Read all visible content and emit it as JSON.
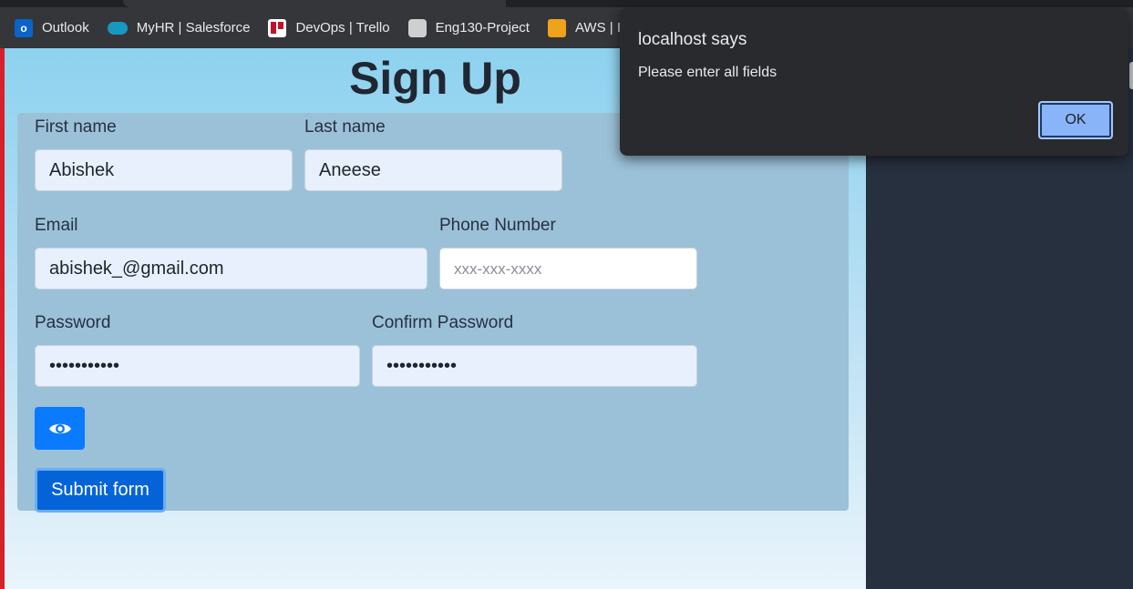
{
  "bookmarks": [
    {
      "label": "Outlook",
      "icon": "outlook-icon"
    },
    {
      "label": "MyHR | Salesforce",
      "icon": "salesforce-icon"
    },
    {
      "label": "DevOps | Trello",
      "icon": "trello-icon"
    },
    {
      "label": "Eng130-Project",
      "icon": "project-icon"
    },
    {
      "label": "AWS | Ins",
      "icon": "aws-icon"
    }
  ],
  "page": {
    "title": "Sign Up"
  },
  "form": {
    "first_name": {
      "label": "First name",
      "value": "Abishek"
    },
    "last_name": {
      "label": "Last name",
      "value": "Aneese"
    },
    "email": {
      "label": "Email",
      "value": "abishek_@gmail.com"
    },
    "phone": {
      "label": "Phone Number",
      "value": "",
      "placeholder": "xxx-xxx-xxxx"
    },
    "password": {
      "label": "Password",
      "value": "•••••••••••"
    },
    "confirm_password": {
      "label": "Confirm Password",
      "value": "•••••••••••"
    },
    "toggle_icon": "eye-icon",
    "submit_label": "Submit form"
  },
  "dialog": {
    "title": "localhost says",
    "message": "Please enter all fields",
    "ok_label": "OK"
  },
  "colors": {
    "submit": "#0563d8",
    "eye_button": "#0a7aff",
    "dialog_ok": "#8ab4f8"
  }
}
